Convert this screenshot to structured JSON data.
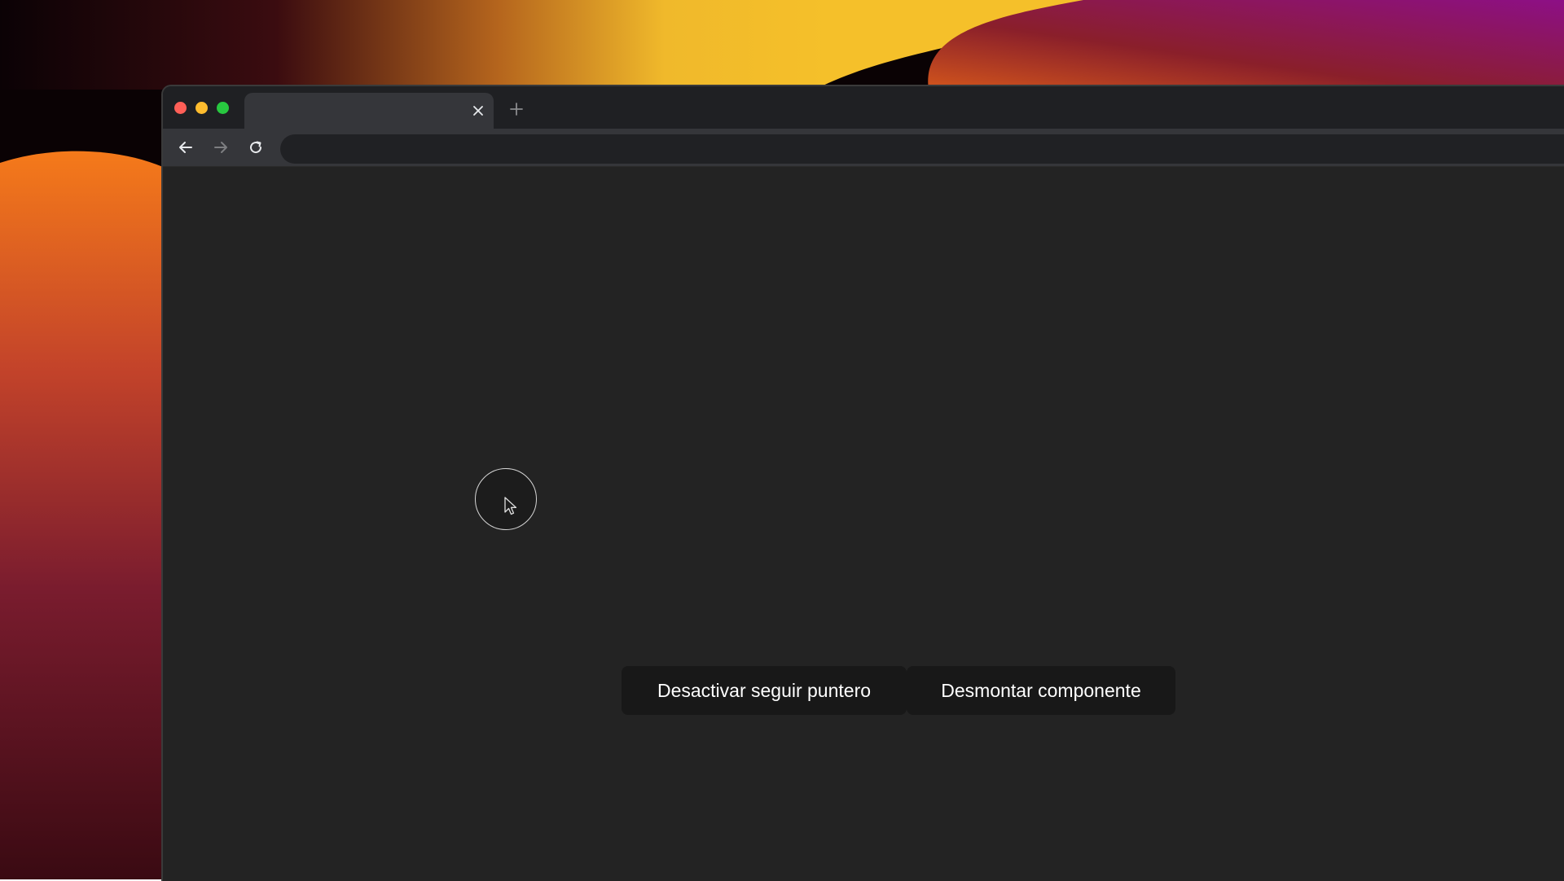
{
  "browser": {
    "tab": {
      "title": ""
    },
    "omnibox": {
      "value": "",
      "placeholder": ""
    }
  },
  "page": {
    "buttons": {
      "toggle_follow_label": "Desactivar seguir puntero",
      "unmount_label": "Desmontar componente"
    }
  },
  "colors": {
    "page_background": "#232323",
    "button_background": "#181818",
    "button_text": "#ffffff",
    "follower_border": "#d6d6d6"
  },
  "icons": {
    "close": "close-icon",
    "new_tab": "plus-icon",
    "back": "arrow-left-icon",
    "forward": "arrow-right-icon",
    "reload": "reload-icon",
    "cursor": "mouse-pointer-icon"
  }
}
